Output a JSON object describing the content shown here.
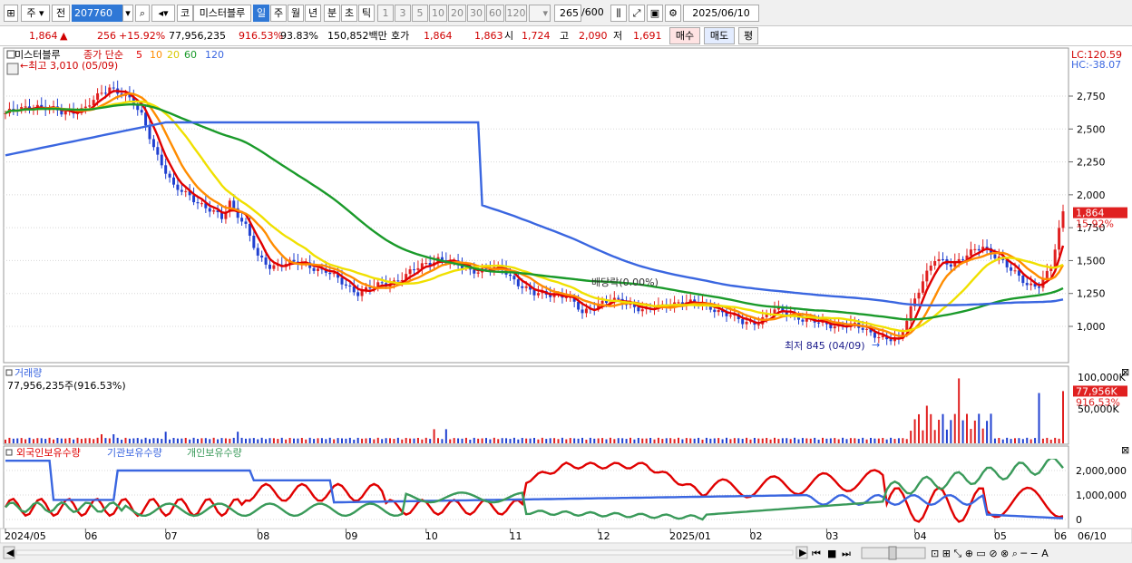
{
  "toolbar": {
    "type_select": "주",
    "jeon": "전",
    "code": "207760",
    "ko_label": "코",
    "stock_name": "미스터블루",
    "periods": [
      "일",
      "주",
      "월",
      "년",
      "분",
      "초",
      "틱"
    ],
    "selected_period": "일",
    "intervals": [
      "1",
      "3",
      "5",
      "10",
      "20",
      "30",
      "60",
      "120"
    ],
    "count": "265",
    "count_total": "/600",
    "date": "2025/06/10"
  },
  "quote": {
    "price": "1,864",
    "direction": "▲",
    "change": "256",
    "change_pct": "+15.92%",
    "volume": "77,956,235",
    "volume_ratio": "916.53%",
    "strength": "93.83%",
    "amount": "150,852백만",
    "hoga_label": "호가",
    "ask": "1,864",
    "bid": "1,863",
    "open_label": "시",
    "open": "1,724",
    "high_label": "고",
    "high": "2,090",
    "low_label": "저",
    "low": "1,691",
    "buy_label": "매수",
    "sell_label": "매도",
    "eval_label": "평"
  },
  "price_panel": {
    "legend_name": "미스터블루",
    "legend_ma": "종가 단순",
    "ma_periods": [
      "5",
      "10",
      "20",
      "60",
      "120"
    ],
    "ma_colors": [
      "#e00000",
      "#ff8c00",
      "#f0e000",
      "#1a9a2a",
      "#3a66e0"
    ],
    "max_annotation": "←최고 3,010 (05/09)",
    "min_annotation": "최저 845 (04/09)",
    "dividend_annotation": "배당락(0.00%)",
    "lc": "LC:120.59",
    "hc": "HC:-38.07",
    "y_ticks": [
      "2,750",
      "2,500",
      "2,250",
      "2,000",
      "1,750",
      "1,500",
      "1,250",
      "1,000"
    ],
    "current_price": "1,864",
    "current_pct": "15.92%"
  },
  "volume_panel": {
    "title": "거래량",
    "info": "77,956,235주(916.53%)",
    "y_ticks": [
      "100,000K",
      "50,000K"
    ],
    "current": "77,956K",
    "current_pct": "916.53%"
  },
  "holdings_panel": {
    "legend": [
      "외국인보유수량",
      "기관보유수량",
      "개인보유수량"
    ],
    "colors": [
      "#e00000",
      "#3a66e0",
      "#3a9a5a"
    ],
    "y_ticks": [
      "2,000,000",
      "1,000,000",
      "0"
    ]
  },
  "x_axis": {
    "labels": [
      "2024/05",
      "06",
      "07",
      "08",
      "09",
      "10",
      "11",
      "12",
      "2025/01",
      "02",
      "03",
      "04",
      "05",
      "06"
    ],
    "right_label": "06/10"
  }
}
